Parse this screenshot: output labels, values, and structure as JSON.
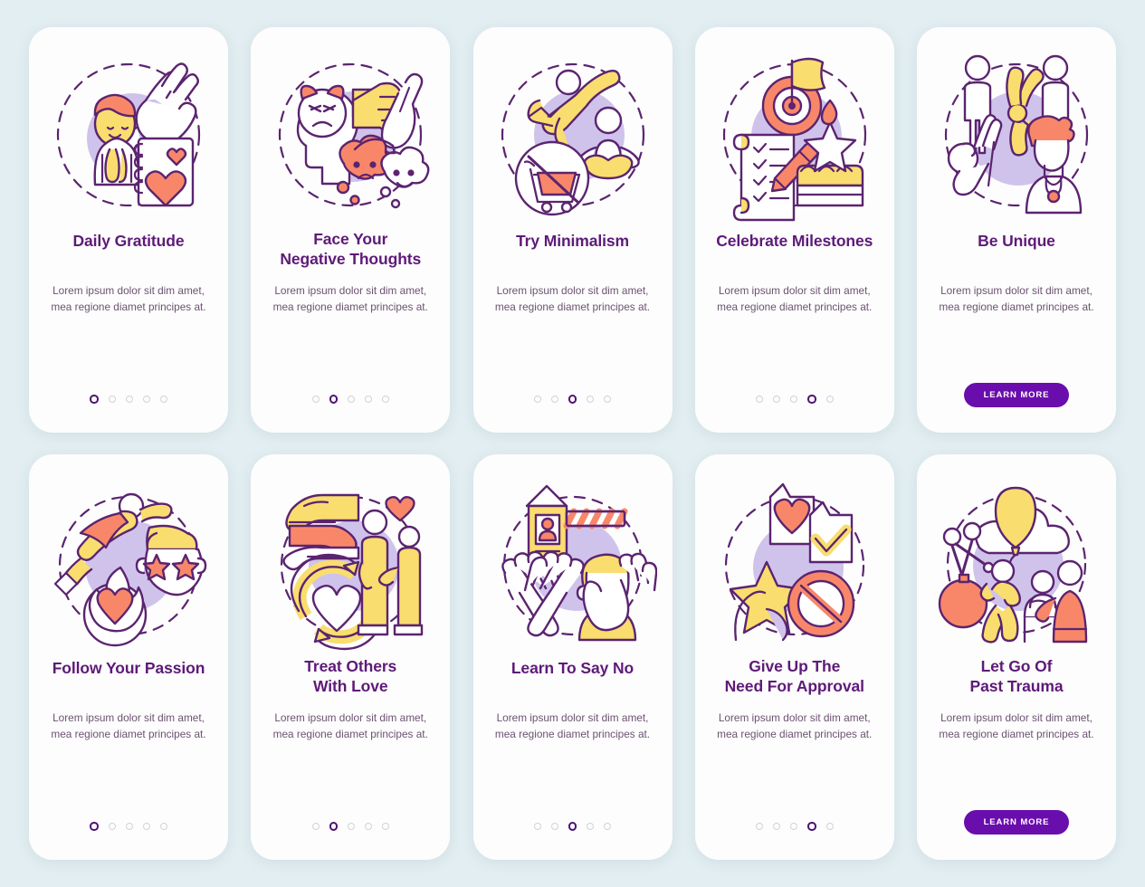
{
  "page": {
    "background_color": "#e2eef1",
    "card_background": "#fdfdfd",
    "title_color": "#5e1a78",
    "body_color": "#6b5270",
    "accent_color": "#6a0dad",
    "dot_active_color": "#4c1273",
    "dot_inactive_color": "#d2d2d8",
    "palette": {
      "outline": "#5b2470",
      "yellow": "#f9dd6e",
      "coral": "#f8876a",
      "lilac": "#cfc3ec",
      "white": "#ffffff"
    }
  },
  "cards": [
    {
      "id": "daily-gratitude",
      "title": "Daily Gratitude",
      "description": "Lorem ipsum dolor sit dim amet, mea regione diamet principes at.",
      "illustration": "praying-person-gratitude-journal-icon",
      "dots": {
        "count": 5,
        "active_index": 0
      },
      "cta": null
    },
    {
      "id": "face-your-negative-thoughts",
      "title": "Face Your\nNegative Thoughts",
      "description": "Lorem ipsum dolor sit dim amet, mea regione diamet principes at.",
      "illustration": "angry-head-fist-mood-change-icon",
      "dots": {
        "count": 5,
        "active_index": 1
      },
      "cta": null
    },
    {
      "id": "try-minimalism",
      "title": "Try Minimalism",
      "description": "Lorem ipsum dolor sit dim amet, mea regione diamet principes at.",
      "illustration": "jumping-meditating-no-shopping-icon",
      "dots": {
        "count": 5,
        "active_index": 2
      },
      "cta": null
    },
    {
      "id": "celebrate-milestones",
      "title": "Celebrate Milestones",
      "description": "Lorem ipsum dolor sit dim amet, mea regione diamet principes at.",
      "illustration": "target-flag-checklist-cake-icon",
      "dots": {
        "count": 5,
        "active_index": 3
      },
      "cta": null
    },
    {
      "id": "be-unique",
      "title": "Be Unique",
      "description": "Lorem ipsum dolor sit dim amet, mea regione diamet principes at.",
      "illustration": "crowd-standout-person-icon",
      "dots": null,
      "cta": "LEARN MORE"
    },
    {
      "id": "follow-your-passion",
      "title": "Follow Your Passion",
      "description": "Lorem ipsum dolor sit dim amet, mea regione diamet principes at.",
      "illustration": "superhero-star-eyes-flaming-heart-icon",
      "dots": {
        "count": 5,
        "active_index": 0
      },
      "cta": null
    },
    {
      "id": "treat-others-with-love",
      "title": "Treat Others\nWith Love",
      "description": "Lorem ipsum dolor sit dim amet, mea regione diamet principes at.",
      "illustration": "caring-hands-heart-cycle-people-icon",
      "dots": {
        "count": 5,
        "active_index": 1
      },
      "cta": null
    },
    {
      "id": "learn-to-say-no",
      "title": "Learn To Say No",
      "description": "Lorem ipsum dolor sit dim amet, mea regione diamet principes at.",
      "illustration": "barrier-crossed-hands-stop-gesture-icon",
      "dots": {
        "count": 5,
        "active_index": 2
      },
      "cta": null
    },
    {
      "id": "give-up-the-need-for-approval",
      "title": "Give Up The\nNeed For Approval",
      "description": "Lorem ipsum dolor sit dim amet, mea regione diamet principes at.",
      "illustration": "like-heart-checkmark-star-prohibited-icon",
      "dots": {
        "count": 5,
        "active_index": 3
      },
      "cta": null
    },
    {
      "id": "let-go-of-past-trauma",
      "title": "Let Go Of\nPast Trauma",
      "description": "Lorem ipsum dolor sit dim amet, mea regione diamet principes at.",
      "illustration": "balloon-cloud-bomb-running-therapy-icon",
      "dots": null,
      "cta": "LEARN MORE"
    }
  ]
}
